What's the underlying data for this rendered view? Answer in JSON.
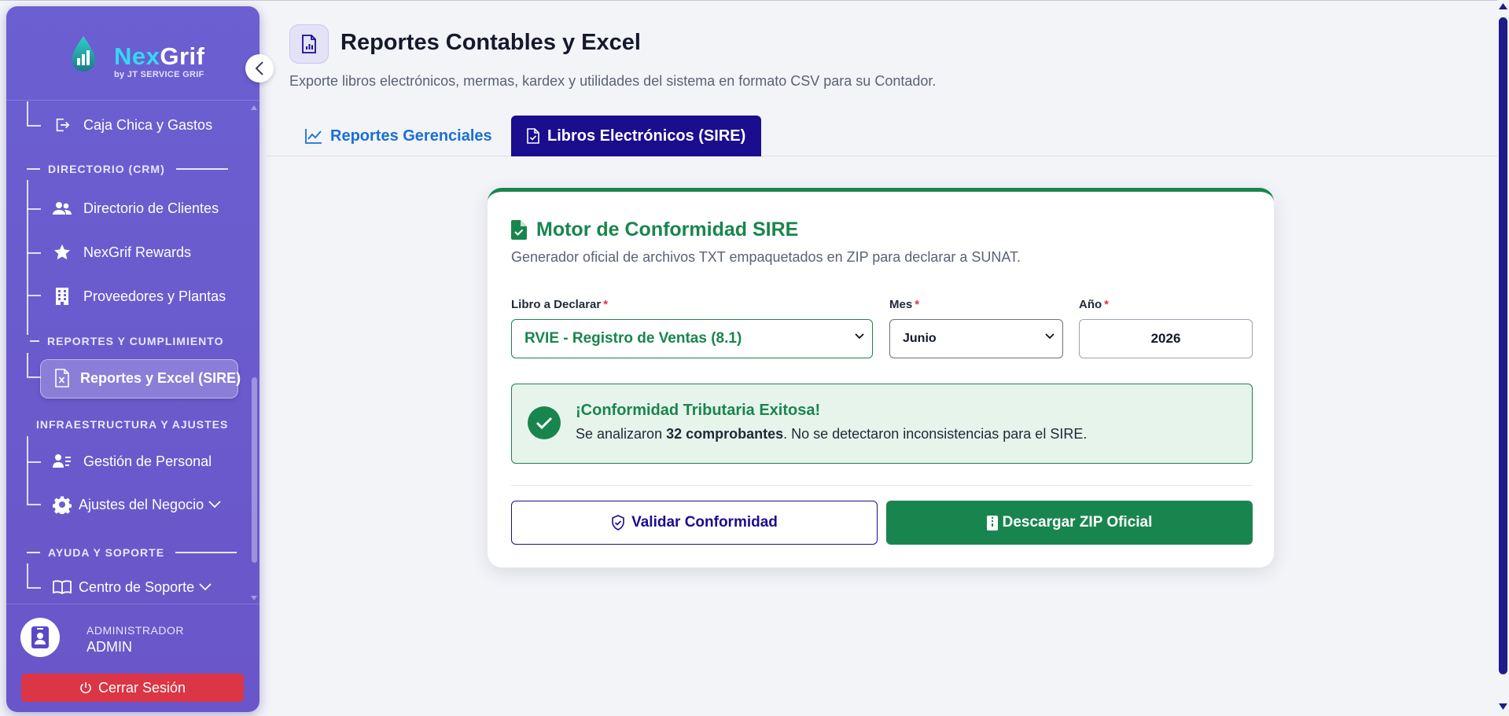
{
  "brand": {
    "name_part1": "Nex",
    "name_part2": "Grif",
    "tagline": "by JT SERVICE GRIF"
  },
  "sidebar": {
    "items": {
      "caja": "Caja Chica y Gastos",
      "clientes": "Directorio de Clientes",
      "rewards": "NexGrif Rewards",
      "proveedores": "Proveedores y Plantas",
      "reportes": "Reportes y Excel (SIRE)",
      "personal": "Gestión de Personal",
      "ajustes": "Ajustes del Negocio",
      "soporte": "Centro de Soporte"
    },
    "sections": {
      "crm": "DIRECTORIO (CRM)",
      "reportes": "REPORTES Y CUMPLIMIENTO",
      "infra": "INFRAESTRUCTURA Y AJUSTES",
      "ayuda": "AYUDA Y SOPORTE"
    },
    "user": {
      "role": "ADMINISTRADOR",
      "name": "ADMIN"
    },
    "logout_label": "Cerrar Sesión"
  },
  "header": {
    "title": "Reportes Contables y Excel",
    "subtitle": "Exporte libros electrónicos, mermas, kardex y utilidades del sistema en formato CSV para su Contador."
  },
  "tabs": [
    {
      "label": "Reportes Gerenciales",
      "active": false
    },
    {
      "label": "Libros Electrónicos (SIRE)",
      "active": true
    }
  ],
  "card": {
    "title": "Motor de Conformidad SIRE",
    "subtitle": "Generador oficial de archivos TXT empaquetados en ZIP para declarar a SUNAT.",
    "fields": {
      "libro": {
        "label": "Libro a Declarar",
        "value": "RVIE - Registro de Ventas (8.1)"
      },
      "mes": {
        "label": "Mes",
        "value": "Junio"
      },
      "anio": {
        "label": "Año",
        "value": "2026"
      },
      "required_mark": "*"
    },
    "alert": {
      "title": "¡Conformidad Tributaria Exitosa!",
      "text_before": "Se analizaron ",
      "count_text": "32 comprobantes",
      "text_after": ". No se detectaron inconsistencias para el SIRE."
    },
    "buttons": {
      "validar": "Validar Conformidad",
      "zip": "Descargar ZIP Oficial"
    }
  },
  "colors": {
    "sidebar": "#6b5fd1",
    "accent_green": "#19854e",
    "accent_navy": "#1a0d8e",
    "danger": "#dc3545",
    "link_blue": "#1a6fd6"
  }
}
